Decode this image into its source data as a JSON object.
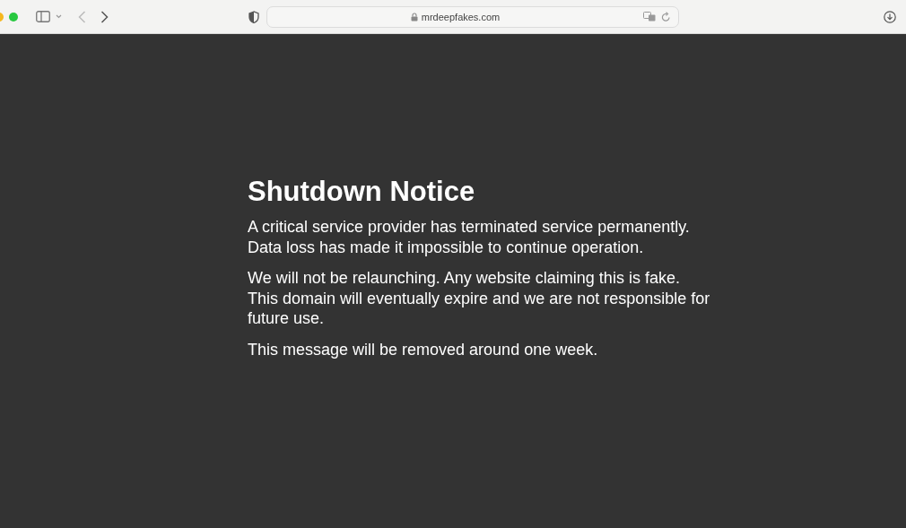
{
  "browser": {
    "address": "mrdeepfakes.com"
  },
  "page": {
    "title": "Shutdown Notice",
    "paragraphs": [
      "A critical service provider has terminated service permanently. Data loss has made it impossible to continue operation.",
      "We will not be relaunching. Any website claiming this is fake. This domain will eventually expire and we are not responsible for future use.",
      "This message will be removed around one week."
    ]
  }
}
